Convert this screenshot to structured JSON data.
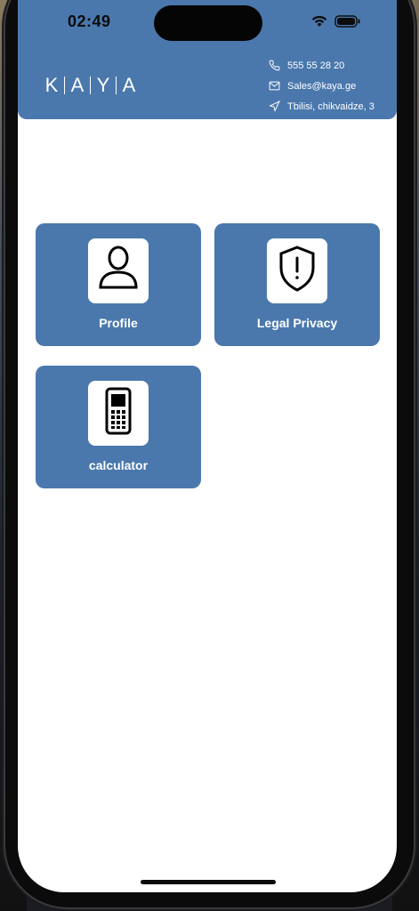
{
  "status_bar": {
    "time": "02:49"
  },
  "header": {
    "logo_letters": [
      "K",
      "A",
      "Y",
      "A"
    ],
    "contacts": [
      {
        "icon": "phone-icon",
        "text": "555 55 28 20"
      },
      {
        "icon": "mail-icon",
        "text": "Sales@kaya.ge"
      },
      {
        "icon": "location-arrow-icon",
        "text": "Tbilisi, chikvaidze, 3"
      }
    ]
  },
  "tiles": [
    {
      "label": "Profile",
      "icon": "person-icon"
    },
    {
      "label": "Legal Privacy",
      "icon": "shield-alert-icon"
    },
    {
      "label": "calculator",
      "icon": "calculator-phone-icon"
    }
  ],
  "colors": {
    "accent": "#4a78ad",
    "background": "#ffffff"
  }
}
